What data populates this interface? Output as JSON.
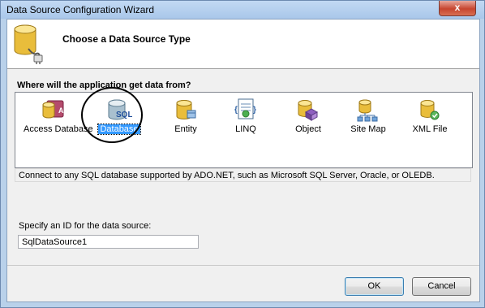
{
  "window": {
    "title": "Data Source Configuration Wizard",
    "close_glyph": "x"
  },
  "header": {
    "title": "Choose a Data Source Type",
    "icon": "database-plug-icon"
  },
  "question": "Where will the application get data from?",
  "data_sources": [
    {
      "label": "Access Database",
      "icon": "access-database-icon",
      "selected": false
    },
    {
      "label": "Database",
      "icon": "sql-database-icon",
      "selected": true
    },
    {
      "label": "Entity",
      "icon": "entity-icon",
      "selected": false
    },
    {
      "label": "LINQ",
      "icon": "linq-icon",
      "selected": false
    },
    {
      "label": "Object",
      "icon": "object-icon",
      "selected": false
    },
    {
      "label": "Site Map",
      "icon": "site-map-icon",
      "selected": false
    },
    {
      "label": "XML File",
      "icon": "xml-file-icon",
      "selected": false
    }
  ],
  "description": "Connect to any SQL database supported by ADO.NET, such as Microsoft SQL Server, Oracle, or OLEDB.",
  "id_field": {
    "label": "Specify an ID for the data source:",
    "value": "SqlDataSource1"
  },
  "buttons": {
    "ok": "OK",
    "cancel": "Cancel"
  },
  "sql_icon_text": "SQL"
}
